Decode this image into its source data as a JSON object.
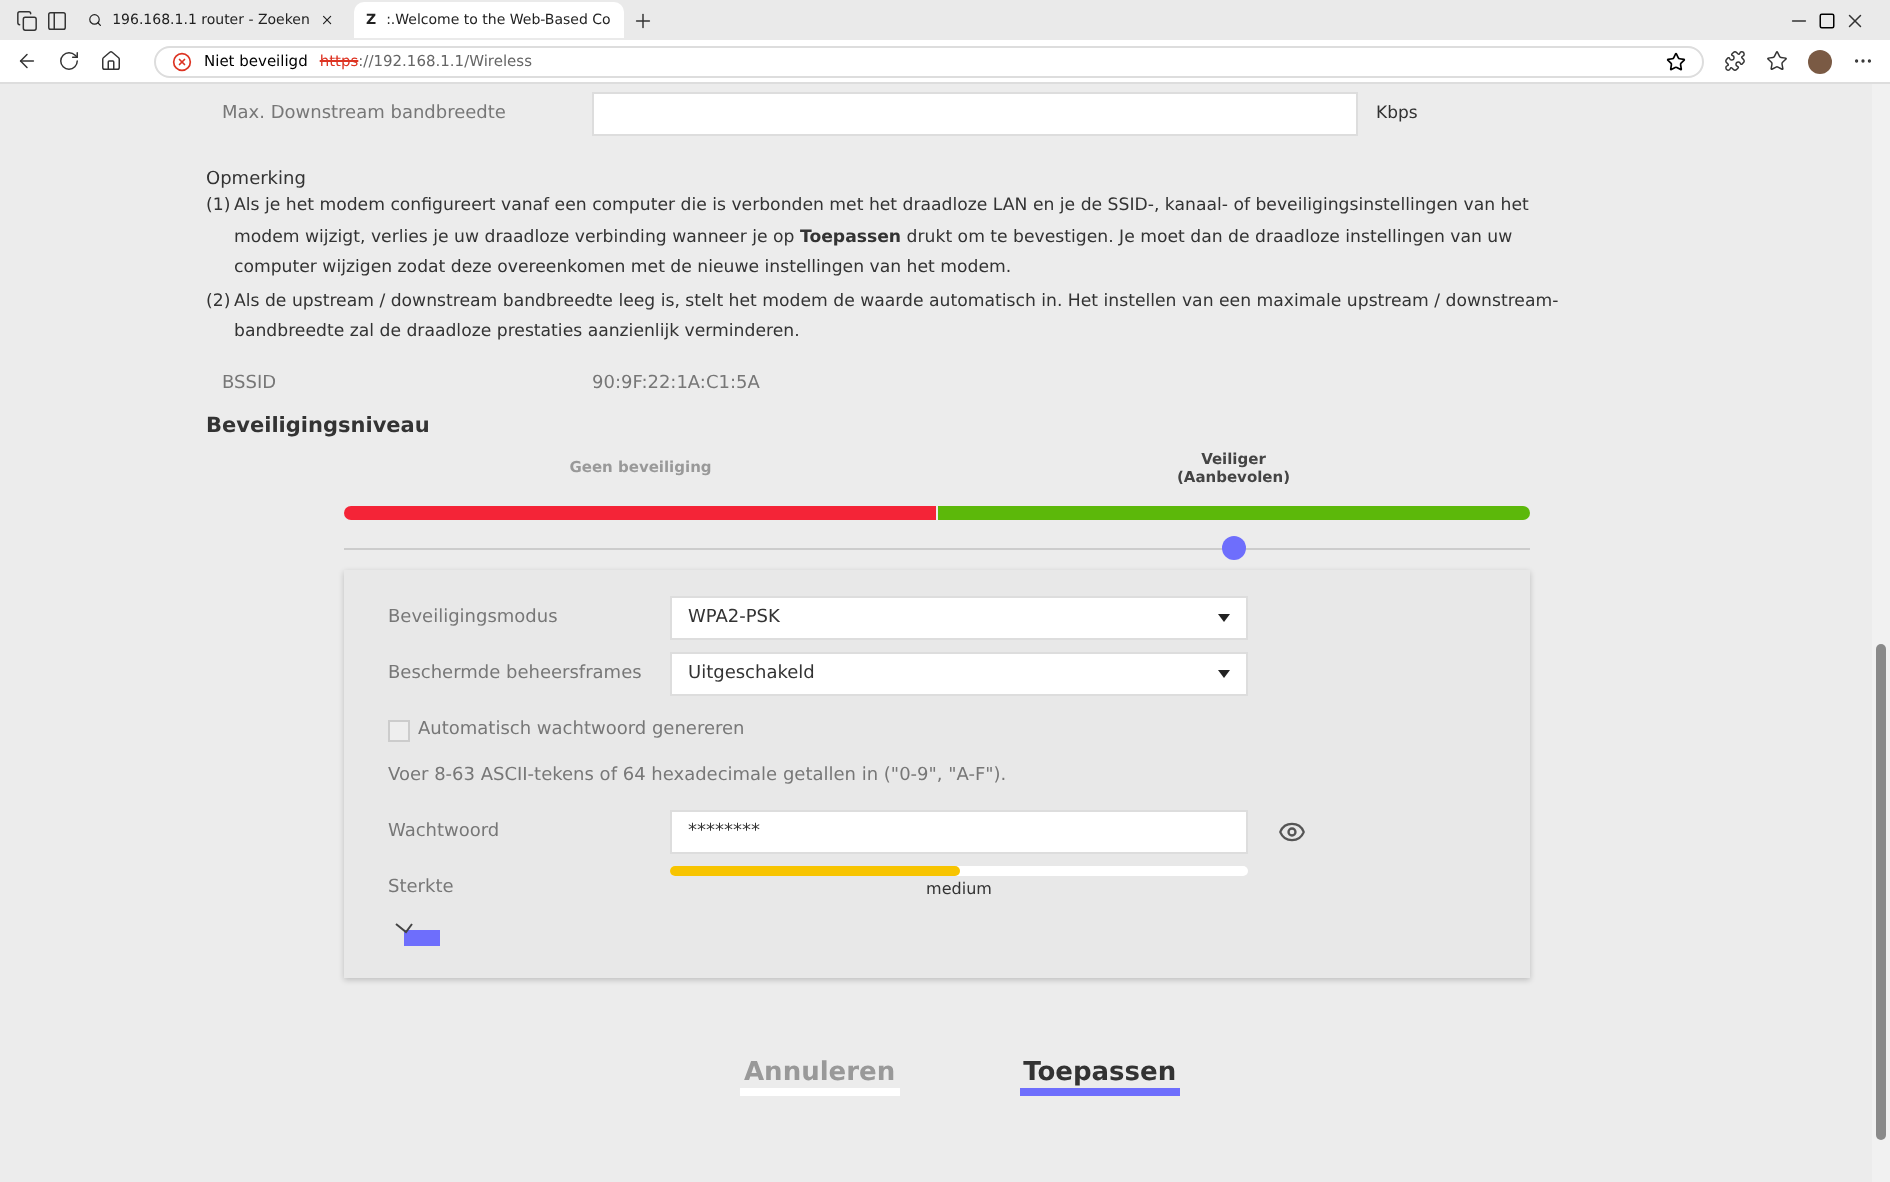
{
  "browser": {
    "tabs": [
      {
        "title": "196.168.1.1 router - Zoeken",
        "selected": false
      },
      {
        "title": ":.Welcome to the Web-Based Co",
        "site_icon": "Z",
        "selected": true
      }
    ],
    "security_warning": "Niet beveiligd",
    "url_scheme": "https",
    "url_rest": "://192.168.1.1/Wireless"
  },
  "downstream": {
    "label": "Max. Downstream bandbreedte",
    "unit": "Kbps"
  },
  "note": {
    "title": "Opmerking",
    "items": [
      {
        "num": "(1)",
        "text": "Als je het modem configureert vanaf een computer die is verbonden met het draadloze LAN en je de SSID-, kanaal- of beveiligingsinstellingen van het modem wijzigt, verlies je uw draadloze verbinding wanneer je op **Toepassen** drukt om te bevestigen. Je moet dan de draadloze instellingen van uw computer wijzigen zodat deze overeenkomen met de nieuwe instellingen van het modem."
      },
      {
        "num": "(2)",
        "text": "Als de upstream / downstream bandbreedte leeg is, stelt het modem de waarde automatisch in. Het instellen van een maximale upstream / downstream-bandbreedte zal de draadloze prestaties aanzienlijk verminderen."
      }
    ]
  },
  "bssid": {
    "label": "BSSID",
    "value": "90:9F:22:1A:C1:5A"
  },
  "security_level": {
    "title": "Beveiligingsniveau",
    "levels": [
      {
        "label": "Geen beveiliging",
        "color": "#f42437",
        "selected": false
      },
      {
        "label": "Veiliger\n(Aanbevolen)",
        "color": "#5cb80a",
        "selected": true
      }
    ]
  },
  "form": {
    "mode_label": "Beveiligingsmodus",
    "mode_value": "WPA2-PSK",
    "pmf_label": "Beschermde beheersframes",
    "pmf_value": "Uitgeschakeld",
    "auto_label": "Automatisch wachtwoord genereren",
    "auto_checked": false,
    "hint": "Voer 8-63 ASCII-tekens of 64 hexadecimale getallen in (\"0-9\", \"A-F\").",
    "password_label": "Wachtwoord",
    "password_value": "********",
    "strength_label": "Sterkte",
    "strength": {
      "level": 0.5,
      "reading": "medium"
    }
  },
  "buttons": {
    "cancel": "Annuleren",
    "apply": "Toepassen"
  }
}
